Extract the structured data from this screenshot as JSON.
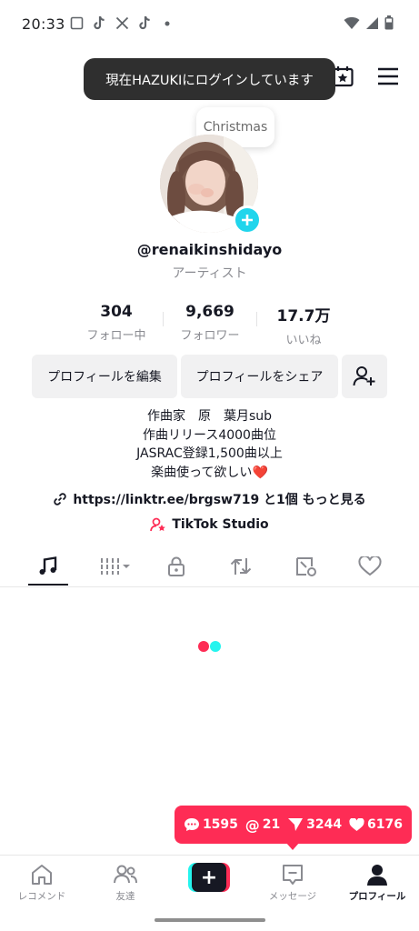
{
  "status_bar": {
    "time": "20:33",
    "left_icons": [
      "screenshot-icon",
      "tiktok-icon",
      "x-icon",
      "tiktok-icon",
      "dot-icon"
    ],
    "right_icons": [
      "wifi-icon",
      "signal-icon",
      "battery-icon"
    ]
  },
  "topbar": {
    "icons": [
      "calendar-star-icon",
      "menu-icon"
    ]
  },
  "toast": {
    "text": "現在HAZUKIにログインしています"
  },
  "note": {
    "text": "Christmas"
  },
  "profile": {
    "username": "@renaikinshidayo",
    "category": "アーティスト"
  },
  "stats": [
    {
      "value": "304",
      "label": "フォロー中"
    },
    {
      "value": "9,669",
      "label": "フォロワー"
    },
    {
      "value": "17.7万",
      "label": "いいね"
    }
  ],
  "buttons": {
    "edit_profile": "プロフィールを編集",
    "share_profile": "プロフィールをシェア"
  },
  "bio": {
    "lines": [
      "作曲家　原　葉月sub",
      "作曲リリース4000曲位",
      "JASRAC登録1,500曲以上",
      "楽曲使って欲しい"
    ],
    "heart": "❤️"
  },
  "link": {
    "text": "https://linktr.ee/brgsw719 と1個 もっと見る"
  },
  "studio": {
    "text": "TikTok Studio"
  },
  "tabs": [
    "music-note-icon",
    "playlist-icon",
    "lock-icon",
    "repost-icon",
    "tagged-icon",
    "heart-outline-icon"
  ],
  "loader_colors": [
    "#fe2c55",
    "#25f4ee"
  ],
  "activity": {
    "comments": "1595",
    "mentions": "21",
    "shares": "3244",
    "likes": "6176"
  },
  "bottom_nav": {
    "home": "レコメンド",
    "friends": "友達",
    "create": "+",
    "inbox": "メッセージ",
    "profile": "プロフィール"
  },
  "colors": {
    "accent": "#fe2c55",
    "cyan": "#25f4ee",
    "avatar_add": "#20d5ec",
    "toast_bg": "#2f2f2f"
  }
}
